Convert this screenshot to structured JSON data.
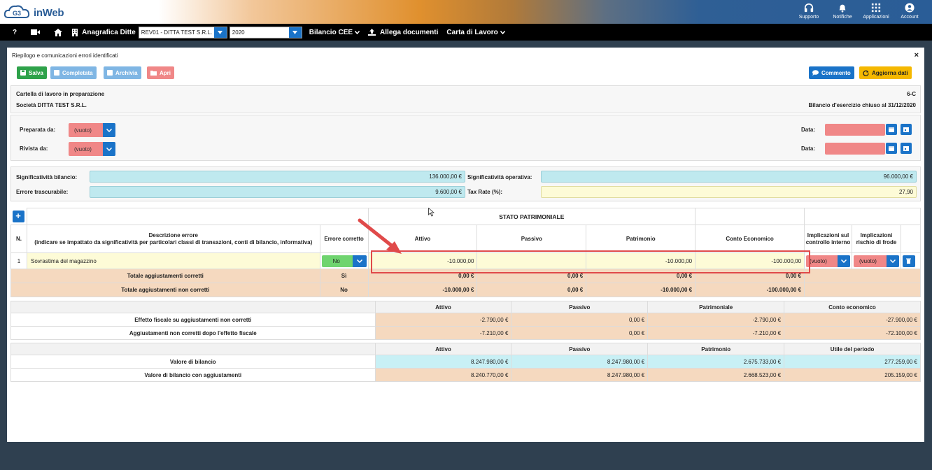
{
  "brand": {
    "name": "inWeb"
  },
  "top_icons": [
    {
      "label": "Supporto",
      "icon": "headset-icon"
    },
    {
      "label": "Notifiche",
      "icon": "bell-icon"
    },
    {
      "label": "Applicazioni",
      "icon": "apps-grid-icon"
    },
    {
      "label": "Account",
      "icon": "account-icon"
    }
  ],
  "navbar": {
    "help": "?",
    "anagrafica_label": "Anagrafica Ditte",
    "company_select": "REV01 - DITTA TEST S.R.L.",
    "year_select": "2020",
    "bilancio_label": "Bilancio CEE",
    "allega_label": "Allega documenti",
    "carta_label": "Carta di Lavoro"
  },
  "panel": {
    "title": "Riepilogo e comunicazioni errori identificati",
    "close": "×",
    "buttons": {
      "salva": "Salva",
      "completata": "Completata",
      "archivia": "Archivia",
      "apri": "Apri",
      "commento": "Commento",
      "aggiorna": "Aggiorna dati"
    },
    "info": {
      "status": "Cartella di lavoro in preparazione",
      "company": "Società DITTA TEST S.R.L.",
      "code": "6-C",
      "period": "Bilancio d'esercizio chiuso al 31/12/2020"
    },
    "prep": {
      "preparata_label": "Preparata da:",
      "preparata_value": "(vuoto)",
      "rivista_label": "Rivista da:",
      "rivista_value": "(vuoto)",
      "data_label": "Data:"
    },
    "sig": {
      "bilancio_label": "Significatività bilancio:",
      "bilancio_value": "136.000,00 €",
      "operativa_label": "Significatività operativa:",
      "operativa_value": "96.000,00 €",
      "errore_label": "Errore trascurabile:",
      "errore_value": "9.600,00 €",
      "tax_label": "Tax Rate (%):",
      "tax_value": "27,90"
    },
    "errors_table": {
      "add": "+",
      "stato_patrimoniale": "STATO PATRIMONIALE",
      "headers": {
        "n": "N.",
        "descrizione": "Descrizione errore",
        "descrizione_sub": "(indicare se impattato da significatività per particolari classi di transazioni, conti di bilancio, informativa)",
        "errore_corretto": "Errore corretto",
        "attivo": "Attivo",
        "passivo": "Passivo",
        "patrimonio": "Patrimonio",
        "conto_economico": "Conto Economico",
        "impl_controllo": "Implicazioni sul controllo interno",
        "impl_frode": "Implicazioni rischio di frode"
      },
      "row": {
        "n": "1",
        "descrizione": "Sovrastima del magazzino",
        "corretto": "No",
        "attivo": "-10.000,00",
        "passivo": "",
        "patrimonio": "-10.000,00",
        "conto_economico": "-100.000,00",
        "controllo": "(vuoto)",
        "frode": "(vuoto)"
      },
      "totali_corretti": {
        "label": "Totale aggiustamenti corretti",
        "flag": "Sì",
        "attivo": "0,00 €",
        "passivo": "0,00 €",
        "patrimonio": "0,00 €",
        "conto_economico": "0,00 €"
      },
      "totali_non_corretti": {
        "label": "Totale aggiustamenti non corretti",
        "flag": "No",
        "attivo": "-10.000,00 €",
        "passivo": "0,00 €",
        "patrimonio": "-10.000,00 €",
        "conto_economico": "-100.000,00 €"
      }
    },
    "fiscal_table": {
      "headers": [
        "Attivo",
        "Passivo",
        "Patrimoniale",
        "Conto economico"
      ],
      "rows": [
        {
          "label": "Effetto fiscale su aggiustamenti non corretti",
          "values": [
            "-2.790,00 €",
            "0,00 €",
            "-2.790,00 €",
            "-27.900,00 €"
          ]
        },
        {
          "label": "Aggiustamenti non corretti dopo l'effetto fiscale",
          "values": [
            "-7.210,00 €",
            "0,00 €",
            "-7.210,00 €",
            "-72.100,00 €"
          ]
        }
      ]
    },
    "balance_table": {
      "headers": [
        "Attivo",
        "Passivo",
        "Patrimonio",
        "Utile del periodo"
      ],
      "rows": [
        {
          "label": "Valore di bilancio",
          "values": [
            "8.247.980,00 €",
            "8.247.980,00 €",
            "2.675.733,00 €",
            "277.259,00 €"
          ]
        },
        {
          "label": "Valore di bilancio con aggiustamenti",
          "values": [
            "8.240.770,00 €",
            "8.247.980,00 €",
            "2.668.523,00 €",
            "205.159,00 €"
          ]
        }
      ]
    }
  },
  "colors": {
    "accent": "#1a73c8",
    "salva": "#2ea24a",
    "completata": "#7fb6e4",
    "apri": "#f08787",
    "aggiorna": "#f5b800",
    "peach": "#f5d9bf",
    "cyan": "#c8f0f5",
    "highlight": "#e04a4a"
  }
}
